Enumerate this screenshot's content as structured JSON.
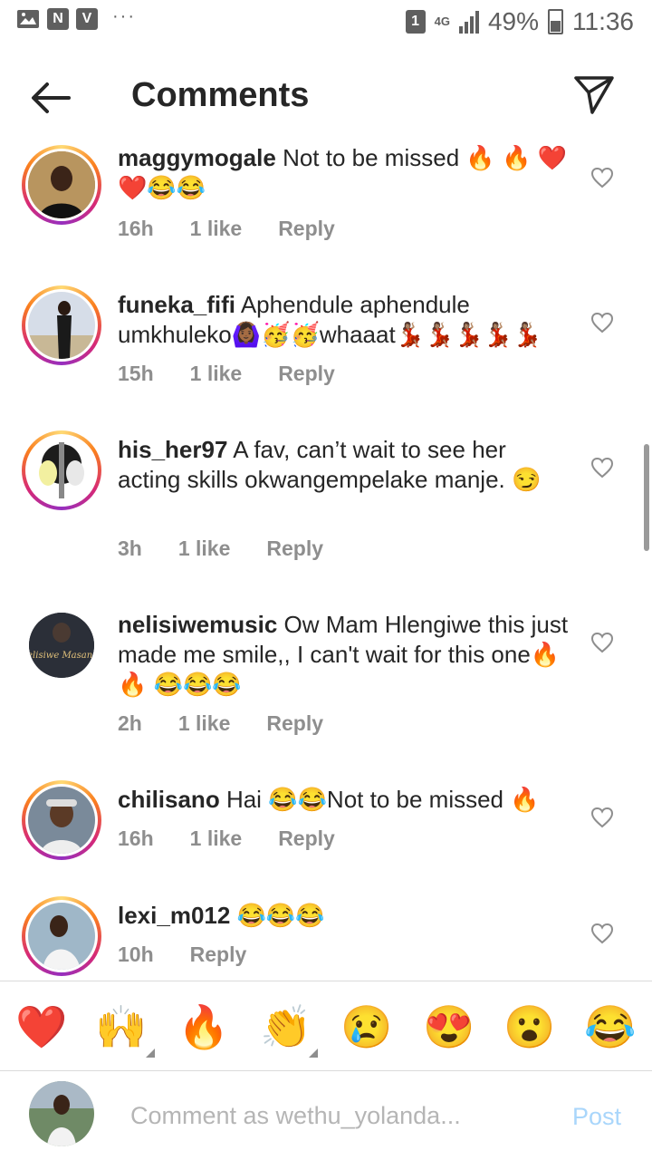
{
  "status_bar": {
    "left_icons": [
      "image-icon",
      "n-icon",
      "v-icon"
    ],
    "n_label": "N",
    "v_label": "V",
    "dots": "···",
    "sim": "1",
    "network": "4G",
    "battery": "49%",
    "time": "11:36"
  },
  "header": {
    "title": "Comments"
  },
  "comments": [
    {
      "username": "maggymogale",
      "text": "Not to be missed 🔥 🔥 ❤️❤️😂😂",
      "time": "16h",
      "likes": "1 like",
      "reply": "Reply"
    },
    {
      "username": "funeka_fifi",
      "text": "Aphendule aphendule umkhuleko🙆🏾‍♀️🥳🥳whaaat💃🏽💃🏽💃🏽💃🏽💃🏽",
      "time": "15h",
      "likes": "1 like",
      "reply": "Reply"
    },
    {
      "username": "his_her97",
      "text": "A fav, can’t wait to see her acting skills okwangempelake manje. 😏",
      "time": "3h",
      "likes": "1 like",
      "reply": "Reply"
    },
    {
      "username": "nelisiwemusic",
      "text": "Ow Mam Hlengiwe this just made me smile,, I can't wait for this one🔥 🔥 😂😂😂",
      "time": "2h",
      "likes": "1 like",
      "reply": "Reply",
      "avatar_text": "Nelisiwe Masango"
    },
    {
      "username": "chilisano",
      "text": "Hai 😂😂Not to be missed 🔥",
      "time": "16h",
      "likes": "1 like",
      "reply": "Reply"
    },
    {
      "username": "lexi_m012",
      "text": "😂😂😂",
      "time": "10h",
      "reply": "Reply"
    }
  ],
  "emoji_bar": [
    "❤️",
    "🙌",
    "🔥",
    "👏",
    "😢",
    "😍",
    "😮",
    "😂"
  ],
  "composer": {
    "placeholder": "Comment as wethu_yolanda...",
    "post_label": "Post"
  },
  "colors": {
    "text": "#262626",
    "meta": "#8e8e8e",
    "post_disabled": "#a9d6fb",
    "divider": "#dbdbdb"
  }
}
